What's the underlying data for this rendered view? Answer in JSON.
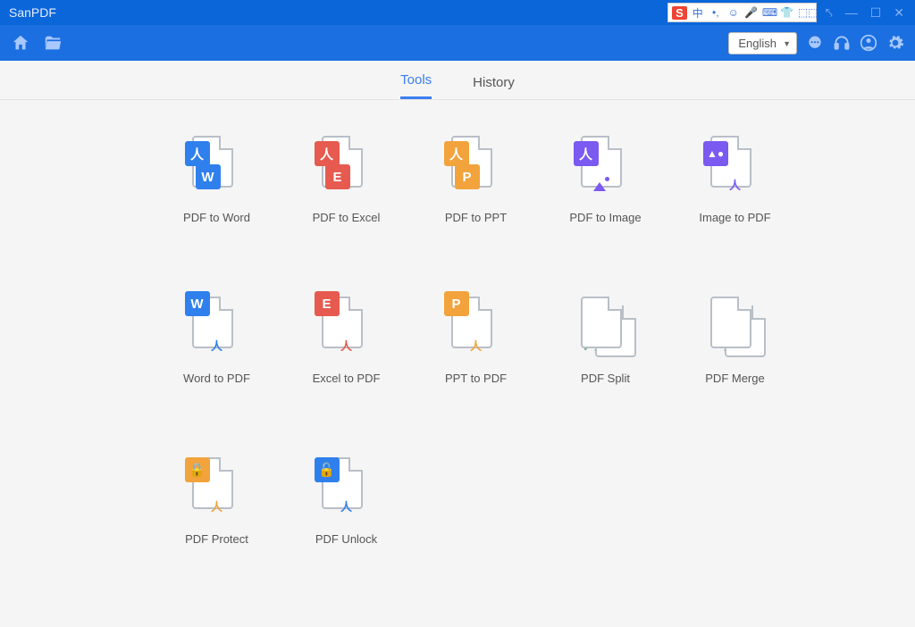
{
  "titlebar": {
    "title": "SanPDF"
  },
  "ime": {
    "items": [
      "中",
      "•,",
      "☺",
      "🎤",
      "⌨",
      "👕",
      "⬚⬚"
    ]
  },
  "toolbar": {
    "language": "English"
  },
  "tabs": {
    "tools": "Tools",
    "history": "History",
    "active": "tools"
  },
  "tools": [
    {
      "id": "pdf-to-word",
      "label": "PDF to Word"
    },
    {
      "id": "pdf-to-excel",
      "label": "PDF to Excel"
    },
    {
      "id": "pdf-to-ppt",
      "label": "PDF to PPT"
    },
    {
      "id": "pdf-to-image",
      "label": "PDF to Image"
    },
    {
      "id": "image-to-pdf",
      "label": "Image to PDF"
    },
    {
      "id": "word-to-pdf",
      "label": "Word to PDF"
    },
    {
      "id": "excel-to-pdf",
      "label": "Excel to PDF"
    },
    {
      "id": "ppt-to-pdf",
      "label": "PPT to PDF"
    },
    {
      "id": "pdf-split",
      "label": "PDF Split"
    },
    {
      "id": "pdf-merge",
      "label": "PDF Merge"
    },
    {
      "id": "pdf-protect",
      "label": "PDF Protect"
    },
    {
      "id": "pdf-unlock",
      "label": "PDF Unlock"
    }
  ]
}
